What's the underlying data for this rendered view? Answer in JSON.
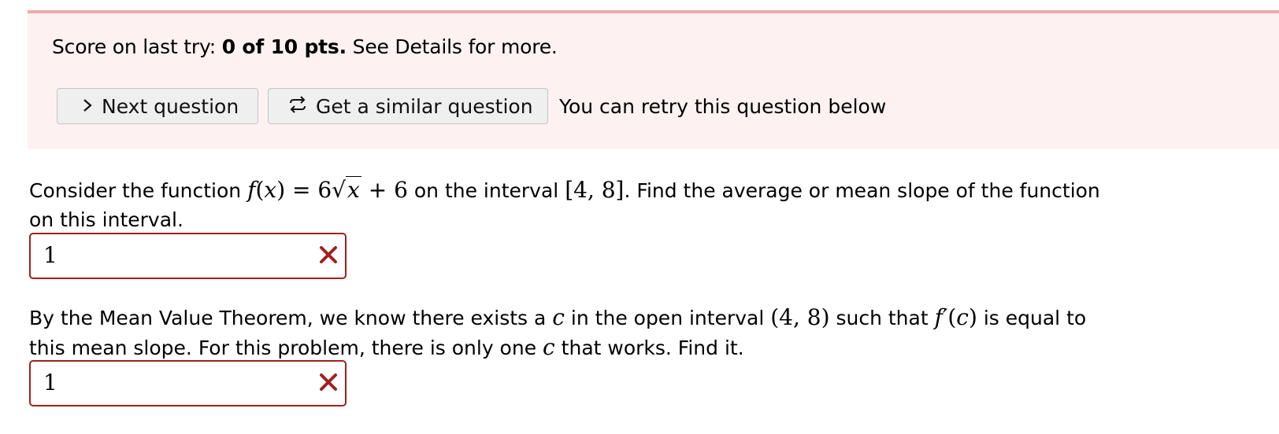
{
  "banner": {
    "score_prefix": "Score on last try: ",
    "score_value": "0 of 10 pts.",
    "score_suffix": " See Details for more.",
    "next_label": "Next question",
    "similar_label": "Get a similar question",
    "retry_note": "You can retry this question below"
  },
  "colors": {
    "banner_bg": "#fdf1f1",
    "banner_border": "#f2a9a9",
    "error": "#a12020"
  },
  "question1": {
    "t1": "Consider the function ",
    "t2": " on the interval ",
    "t3": ". Find the average or mean slope of the function on this interval.",
    "fn_name": "f",
    "var": "x",
    "eq": ") = 6",
    "plus": " + 6",
    "interval": "[4, 8]",
    "answer": "1"
  },
  "question2": {
    "t1": "By the Mean Value Theorem, we know there exists a ",
    "c": "c",
    "t2": " in the open interval ",
    "interval": "(4, 8)",
    "t3": " such that ",
    "fprime": "f′",
    "t4": " is equal to this mean slope. For this problem, there is only one ",
    "t5": " that works. Find it.",
    "answer": "1"
  }
}
